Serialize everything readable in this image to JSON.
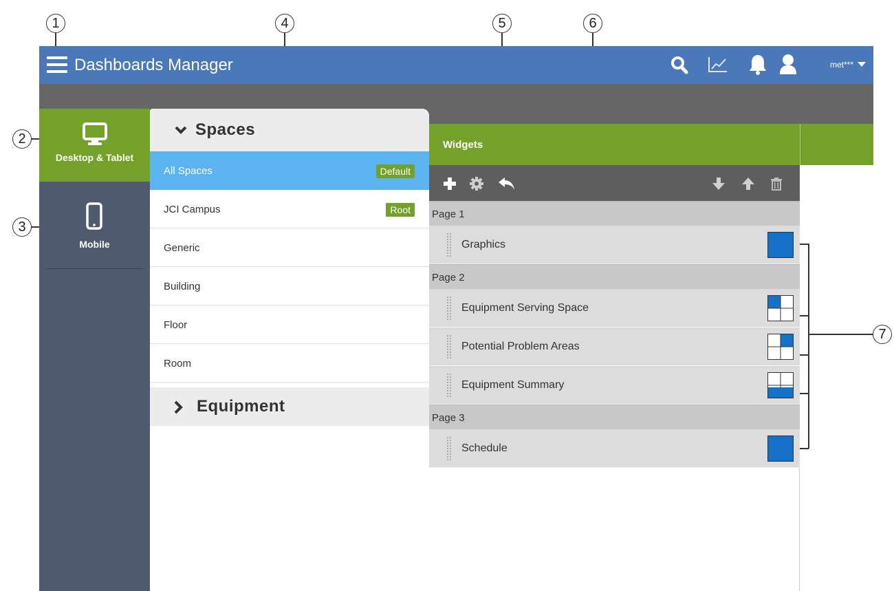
{
  "callouts": [
    "1",
    "2",
    "3",
    "4",
    "5",
    "6",
    "7"
  ],
  "header": {
    "title": "Dashboards Manager",
    "user": "met***",
    "icons": [
      "menu-icon",
      "search-icon",
      "trend-chart-icon",
      "bell-icon",
      "user-icon",
      "caret-down-icon"
    ]
  },
  "nav": {
    "desktop_label": "Desktop & Tablet",
    "mobile_label": "Mobile",
    "active": "Desktop & Tablet"
  },
  "spaces": {
    "title": "Spaces",
    "items": [
      {
        "label": "All Spaces",
        "badge": "Default",
        "selected": true
      },
      {
        "label": "JCI Campus",
        "badge": "Root"
      },
      {
        "label": "Generic"
      },
      {
        "label": "Building"
      },
      {
        "label": "Floor"
      },
      {
        "label": "Room"
      }
    ],
    "equipment_title": "Equipment"
  },
  "widgets": {
    "title": "Widgets",
    "toolbar_icons": [
      "add-icon",
      "gear-icon",
      "undo-icon",
      "move-down-icon",
      "move-up-icon",
      "trash-icon"
    ],
    "pages": [
      {
        "label": "Page 1",
        "items": [
          {
            "label": "Graphics",
            "layout": "full"
          }
        ]
      },
      {
        "label": "Page 2",
        "items": [
          {
            "label": "Equipment Serving Space",
            "layout": "top-left"
          },
          {
            "label": "Potential Problem Areas",
            "layout": "top-right"
          },
          {
            "label": "Equipment Summary",
            "layout": "bottom"
          }
        ]
      },
      {
        "label": "Page 3",
        "items": [
          {
            "label": "Schedule",
            "layout": "full"
          }
        ]
      }
    ]
  },
  "colors": {
    "header": "#4a78b8",
    "accent_green": "#73a12a",
    "selected_blue": "#5bb3ef",
    "nav_dark": "#4f5a6e",
    "widget_blue": "#1470c8"
  }
}
